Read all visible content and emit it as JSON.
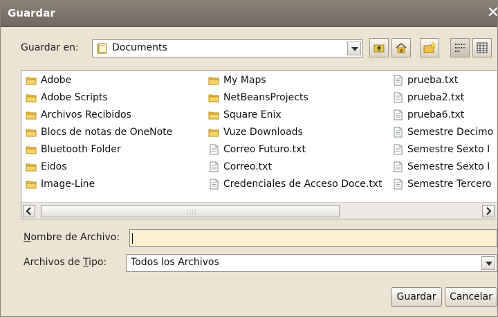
{
  "window": {
    "title": "Guardar",
    "close_glyph": "✕"
  },
  "location": {
    "label": "Guardar en:",
    "value": "Documents",
    "icon": "documents-icon"
  },
  "toolbar": {
    "buttons": [
      "up-one-level-icon",
      "home-icon",
      "new-folder-icon",
      "list-view-icon",
      "details-view-icon"
    ]
  },
  "files": {
    "columns": [
      [
        {
          "name": "Adobe",
          "type": "folder"
        },
        {
          "name": "Adobe Scripts",
          "type": "folder"
        },
        {
          "name": "Archivos Recibidos",
          "type": "folder"
        },
        {
          "name": "Blocs de notas de OneNote",
          "type": "folder"
        },
        {
          "name": "Bluetooth Folder",
          "type": "folder"
        },
        {
          "name": "Eidos",
          "type": "folder"
        },
        {
          "name": "Image-Line",
          "type": "folder"
        }
      ],
      [
        {
          "name": "My Maps",
          "type": "folder"
        },
        {
          "name": "NetBeansProjects",
          "type": "folder"
        },
        {
          "name": "Square Enix",
          "type": "folder"
        },
        {
          "name": "Vuze Downloads",
          "type": "folder"
        },
        {
          "name": "Correo Futuro.txt",
          "type": "file"
        },
        {
          "name": "Correo.txt",
          "type": "file"
        },
        {
          "name": "Credenciales de Acceso Doce.txt",
          "type": "file"
        }
      ],
      [
        {
          "name": "prueba.txt",
          "type": "file"
        },
        {
          "name": "prueba2.txt",
          "type": "file"
        },
        {
          "name": "prueba6.txt",
          "type": "file"
        },
        {
          "name": "Semestre Decimo",
          "type": "file"
        },
        {
          "name": "Semestre Sexto I",
          "type": "file"
        },
        {
          "name": "Semestre Sexto I",
          "type": "file"
        },
        {
          "name": "Semestre Tercero",
          "type": "file"
        }
      ]
    ]
  },
  "filename": {
    "label_u": "N",
    "label_rest": "ombre de Archivo:",
    "value": ""
  },
  "filetype": {
    "label_pre": "Archivos de ",
    "label_u": "T",
    "label_post": "ipo:",
    "value": "Todos los Archivos"
  },
  "buttons": {
    "save": "Guardar",
    "cancel": "Cancelar"
  }
}
